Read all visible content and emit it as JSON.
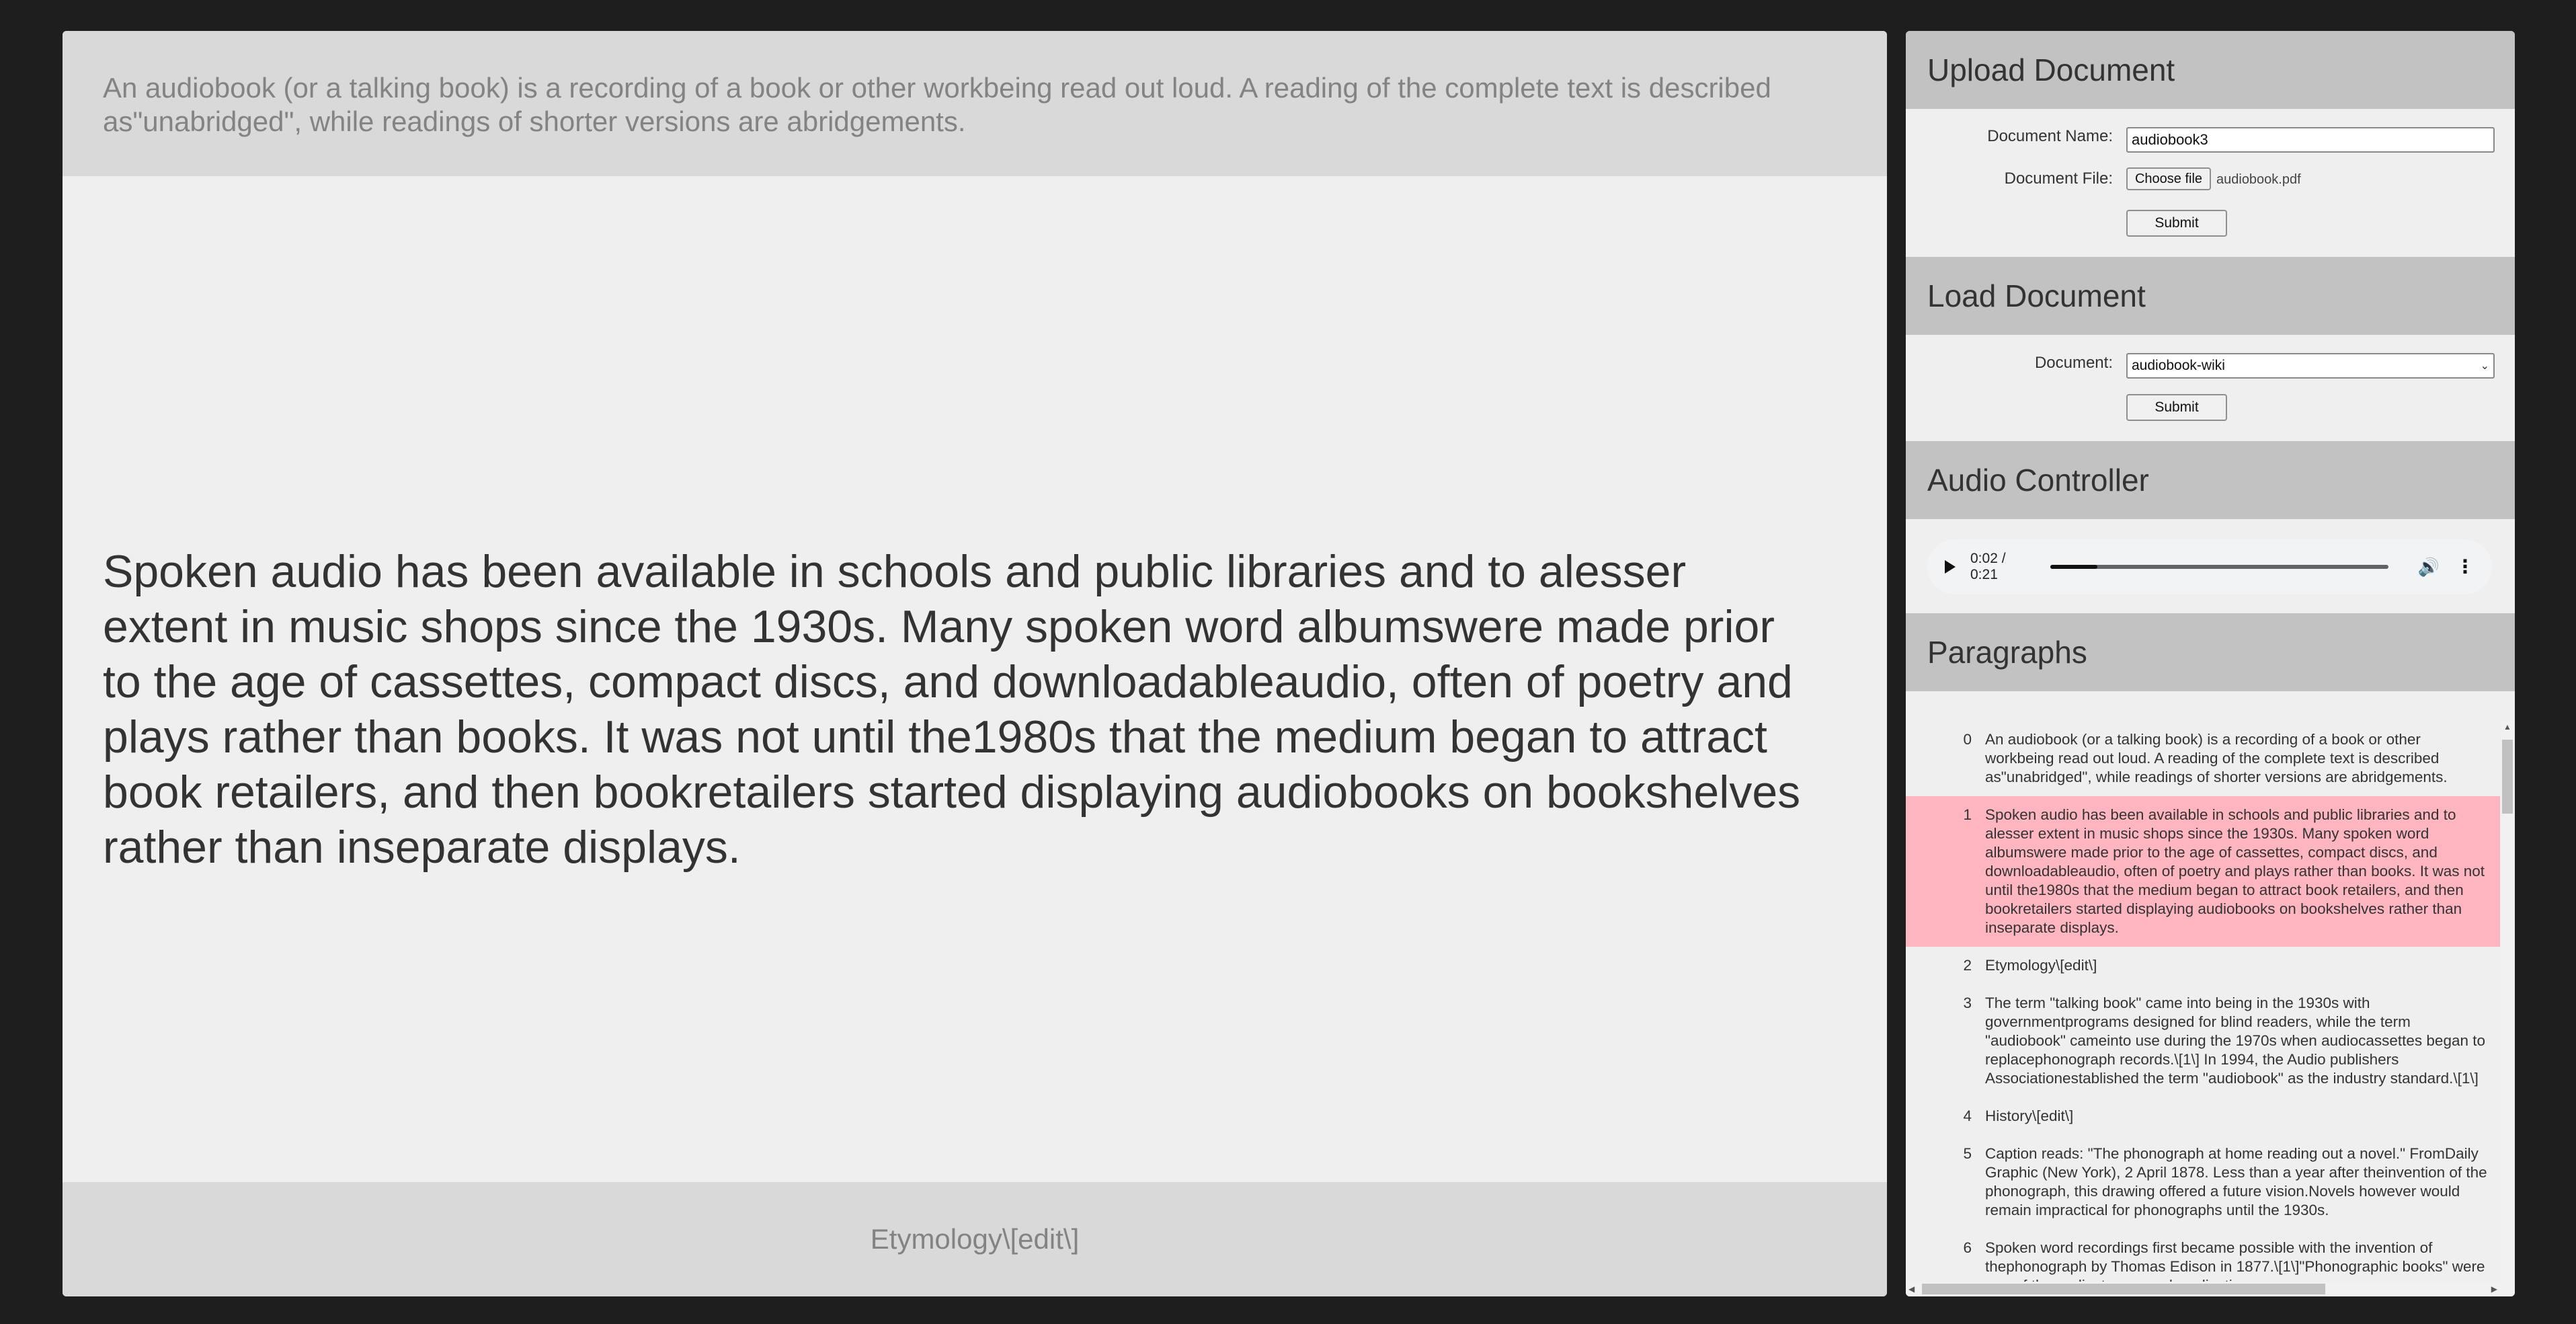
{
  "reader": {
    "previous": "An audiobook (or a talking book) is a recording of a book or other workbeing read out loud. A reading of the complete text is described as\"unabridged\", while readings of shorter versions are abridgements.",
    "current": "Spoken audio has been available in schools and public libraries and to alesser extent in music shops since the 1930s. Many spoken word albumswere made prior to the age of cassettes, compact discs, and downloadableaudio, often of poetry and plays rather than books. It was not until the1980s that the medium began to attract book retailers, and then bookretailers started displaying audiobooks on bookshelves rather than inseparate displays.",
    "next": "Etymology\\[edit\\]"
  },
  "upload": {
    "title": "Upload Document",
    "name_label": "Document Name:",
    "name_value": "audiobook3",
    "file_label": "Document File:",
    "file_button": "Choose file",
    "file_name": "audiobook.pdf",
    "submit": "Submit"
  },
  "load": {
    "title": "Load Document",
    "doc_label": "Document:",
    "doc_value": "audiobook-wiki",
    "submit": "Submit"
  },
  "audio": {
    "title": "Audio Controller",
    "time": "0:02 / 0:21",
    "progress": 0.14,
    "icons": [
      "play-icon",
      "volume-icon",
      "more-options-icon"
    ]
  },
  "paragraphs": {
    "title": "Paragraphs",
    "active_index": 1,
    "items": [
      {
        "num": "0",
        "text": "An audiobook (or a talking book) is a recording of a book or other workbeing read out loud. A reading of the complete text is described as\"unabridged\", while readings of shorter versions are abridgements."
      },
      {
        "num": "1",
        "text": "Spoken audio has been available in schools and public libraries and to alesser extent in music shops since the 1930s. Many spoken word albumswere made prior to the age of cassettes, compact discs, and downloadableaudio, often of poetry and plays rather than books. It was not until the1980s that the medium began to attract book retailers, and then bookretailers started displaying audiobooks on bookshelves rather than inseparate displays."
      },
      {
        "num": "2",
        "text": "Etymology\\[edit\\]"
      },
      {
        "num": "3",
        "text": "The term \"talking book\" came into being in the 1930s with governmentprograms designed for blind readers, while the term \"audiobook\" cameinto use during the 1970s when audiocassettes began to replacephonograph records.\\[1\\] In 1994, the Audio publishers Associationestablished the term \"audiobook\" as the industry standard.\\[1\\]"
      },
      {
        "num": "4",
        "text": "History\\[edit\\]"
      },
      {
        "num": "5",
        "text": "Caption reads: \"The phonograph at home reading out a novel.\" FromDaily Graphic (New York), 2 April 1878. Less than a year after theinvention of the phonograph, this drawing offered a future vision.Novels however would remain impractical for phonographs until the 1930s."
      },
      {
        "num": "6",
        "text": "Spoken word recordings first became possible with the invention of thephonograph by Thomas Edison in 1877.\\[1\\]\"Phonographic books\" were one of the earliest proposed applications."
      }
    ]
  }
}
